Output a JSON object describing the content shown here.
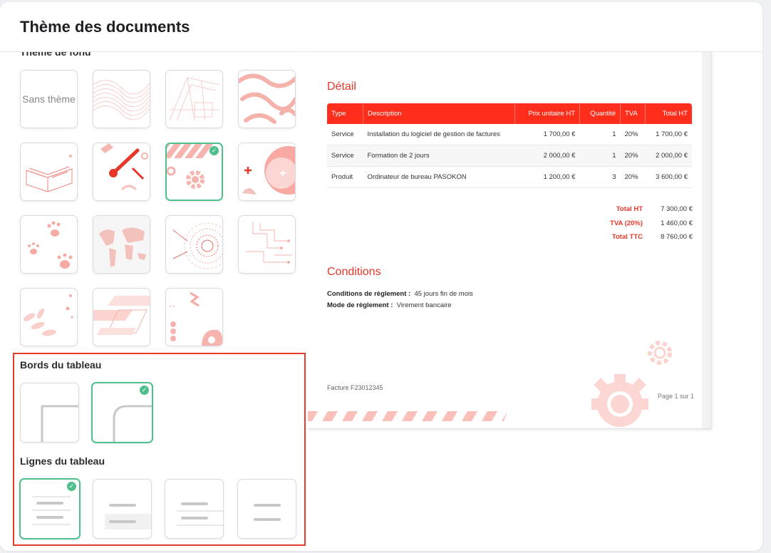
{
  "header": {
    "title": "Thème des documents"
  },
  "left": {
    "background_section_title": "Thème de fond",
    "no_theme_label": "Sans thème",
    "borders_title": "Bords du tableau",
    "lines_title": "Lignes du tableau"
  },
  "themes": [
    {
      "name": "sans-theme",
      "selected": false
    },
    {
      "name": "wave-lines",
      "selected": false
    },
    {
      "name": "architecture",
      "selected": false
    },
    {
      "name": "swirls",
      "selected": false
    },
    {
      "name": "open-book",
      "selected": false
    },
    {
      "name": "tools",
      "selected": false
    },
    {
      "name": "gears-stripes",
      "selected": true
    },
    {
      "name": "medical",
      "selected": false
    },
    {
      "name": "paw-prints",
      "selected": false
    },
    {
      "name": "world-map",
      "selected": false
    },
    {
      "name": "tech-circle",
      "selected": false
    },
    {
      "name": "circuit",
      "selected": false
    },
    {
      "name": "leaves",
      "selected": false
    },
    {
      "name": "parallelograms",
      "selected": false
    },
    {
      "name": "shapes",
      "selected": false
    }
  ],
  "borders": [
    {
      "name": "square-corners",
      "selected": false
    },
    {
      "name": "rounded-corners",
      "selected": true
    }
  ],
  "lines": [
    {
      "name": "lines-all",
      "selected": true
    },
    {
      "name": "lines-alternate-fill",
      "selected": false
    },
    {
      "name": "lines-separators",
      "selected": false
    },
    {
      "name": "lines-none",
      "selected": false
    }
  ],
  "colors": {
    "accent": "#e5382a",
    "table_header": "#ff2e1c",
    "selected": "#4fc08d",
    "pattern": "#f7b3ad"
  },
  "preview": {
    "detail_title": "Détail",
    "table": {
      "headers": [
        "Type",
        "Description",
        "Prix unitaire HT",
        "Quantité",
        "TVA",
        "Total HT"
      ],
      "rows": [
        [
          "Service",
          "Installation du logiciel de gestion de factures",
          "1 700,00 €",
          "1",
          "20%",
          "1 700,00 €"
        ],
        [
          "Service",
          "Formation de 2 jours",
          "2 000,00 €",
          "1",
          "20%",
          "2 000,00 €"
        ],
        [
          "Produit",
          "Ordinateur de bureau PASOKON",
          "1 200,00 €",
          "3",
          "20%",
          "3 600,00 €"
        ]
      ]
    },
    "totals": [
      {
        "label": "Total HT",
        "value": "7 300,00 €"
      },
      {
        "label": "TVA (20%)",
        "value": "1 460,00 €"
      },
      {
        "label": "Total TTC",
        "value": "8 760,00 €"
      }
    ],
    "conditions_title": "Conditions",
    "payment_terms_label": "Conditions de règlement :",
    "payment_terms_value": "45 jours fin de mois",
    "payment_method_label": "Mode de règlement :",
    "payment_method_value": "Virement bancaire",
    "invoice_ref": "Facture F23012345",
    "page_number": "Page 1 sur 1"
  }
}
